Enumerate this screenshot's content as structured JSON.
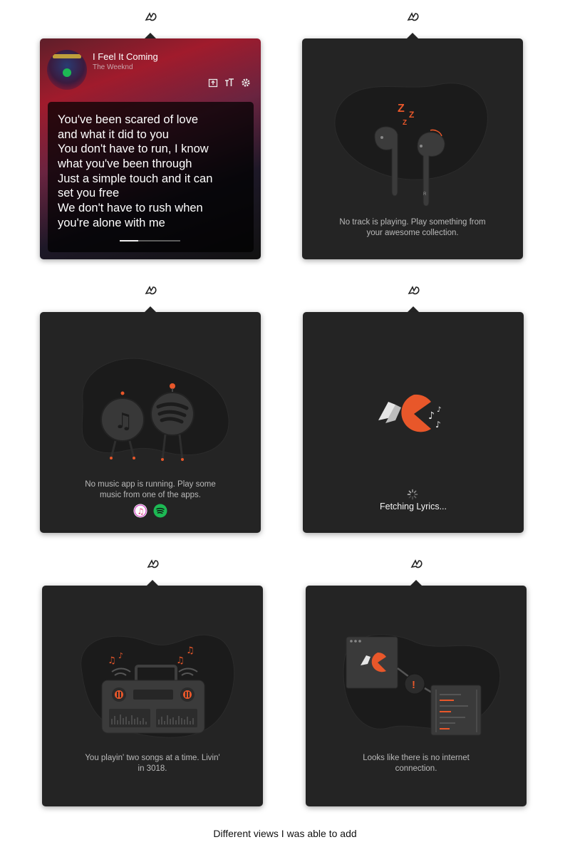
{
  "now_playing": {
    "title": "I Feel It Coming",
    "artist": "The Weeknd",
    "progress": 0.3,
    "lyrics": [
      "You've been scared of love",
      "and what it did to you",
      "You don't have to run, I know",
      "what you've been through",
      "Just a simple touch and it can",
      "set you free",
      "We don't have to rush when",
      "you're alone with me"
    ]
  },
  "no_track": {
    "line1": "No track is playing. Play something from",
    "line2": "your awesome collection."
  },
  "no_app": {
    "line1": "No music app is running. Play some",
    "line2": "music from one of the apps."
  },
  "fetching": {
    "label": "Fetching Lyrics..."
  },
  "two_songs": {
    "line1": "You playin' two songs at a time. Livin'",
    "line2": "in 3018."
  },
  "no_internet": {
    "line1": "Looks like there is no internet",
    "line2": "connection."
  },
  "caption": "Different views I was able to add",
  "colors": {
    "panel_bg": "#242424",
    "accent_orange": "#e8572a",
    "spotify_green": "#1db954"
  },
  "icons": [
    "menu-bar-logo-icon",
    "share-icon",
    "text-size-icon",
    "gear-icon",
    "music-note-icon",
    "spotify-icon",
    "itunes-icon",
    "spinner-icon",
    "warning-icon"
  ]
}
